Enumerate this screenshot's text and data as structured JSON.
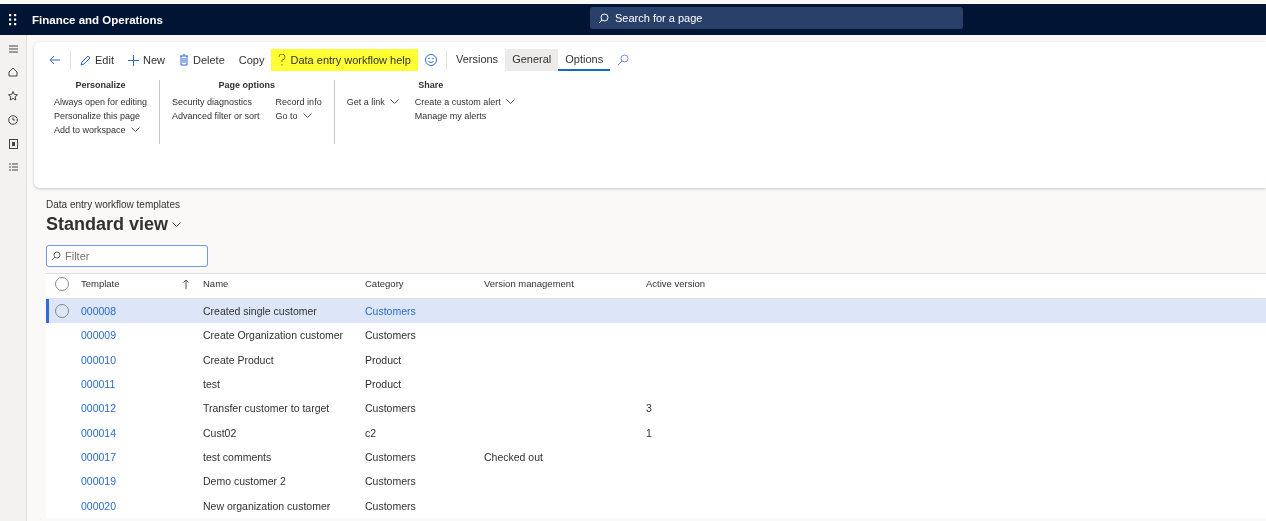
{
  "app_bar": {
    "title": "Finance and Operations",
    "search": {
      "placeholder": "Search for a page"
    }
  },
  "toolbar": {
    "buttons": [
      {
        "kind": "back"
      },
      {
        "kind": "edit",
        "label": "Edit"
      },
      {
        "kind": "new",
        "label": "New"
      },
      {
        "kind": "delete",
        "label": "Delete"
      },
      {
        "kind": "plain",
        "label": "Copy"
      },
      {
        "kind": "help",
        "label": "Data entry workflow help",
        "highlighted": true
      },
      {
        "kind": "smiley"
      }
    ],
    "tabs": [
      {
        "label": "Versions",
        "selected": false,
        "hovered": false
      },
      {
        "label": "General",
        "selected": false,
        "hovered": true
      },
      {
        "label": "Options",
        "selected": true,
        "hovered": false
      }
    ]
  },
  "ribbon": {
    "groups": [
      {
        "title": "Personalize",
        "columns": [
          [
            {
              "label": "Always open for editing",
              "dropdown": false
            },
            {
              "label": "Personalize this page",
              "dropdown": false
            },
            {
              "label": "Add to workspace",
              "dropdown": true
            }
          ]
        ]
      },
      {
        "title": "Page options",
        "columns": [
          [
            {
              "label": "Security diagnostics",
              "dropdown": false
            },
            {
              "label": "Advanced filter or sort",
              "dropdown": false
            }
          ],
          [
            {
              "label": "Record info",
              "dropdown": false
            },
            {
              "label": "Go to",
              "dropdown": true
            }
          ]
        ]
      },
      {
        "title": "Share",
        "columns": [
          [
            {
              "label": "Get a link",
              "dropdown": true
            }
          ],
          [
            {
              "label": "Create a custom alert",
              "dropdown": true
            },
            {
              "label": "Manage my alerts",
              "dropdown": false
            }
          ]
        ]
      }
    ]
  },
  "page": {
    "caption": "Data entry workflow templates",
    "view": "Standard view",
    "filter": {
      "placeholder": "Filter"
    }
  },
  "table": {
    "all_selected": false,
    "columns": [
      "Template",
      "Name",
      "Category",
      "Version management",
      "Active version"
    ],
    "rows": [
      {
        "template": "000008",
        "name": "Created single customer",
        "category": "Customers",
        "selected": true
      },
      {
        "template": "000009",
        "name": "Create Organization customer",
        "category": "Customers",
        "selected": false
      },
      {
        "template": "000010",
        "name": "Create Product",
        "category": "Product",
        "selected": false
      },
      {
        "template": "000011",
        "name": "test",
        "category": "Product",
        "selected": false
      },
      {
        "template": "000012",
        "name": "Transfer customer to target",
        "category": "Customers",
        "active_version": "3",
        "selected": false
      },
      {
        "template": "000014",
        "name": "Cust02",
        "category": "c2",
        "active_version": "1",
        "selected": false
      },
      {
        "template": "000017",
        "name": "test comments",
        "category": "Customers",
        "version_management": "Checked out",
        "selected": false
      },
      {
        "template": "000019",
        "name": "Demo customer 2",
        "category": "Customers",
        "selected": false
      },
      {
        "template": "000020",
        "name": "New organization customer",
        "category": "Customers",
        "selected": false
      }
    ]
  }
}
